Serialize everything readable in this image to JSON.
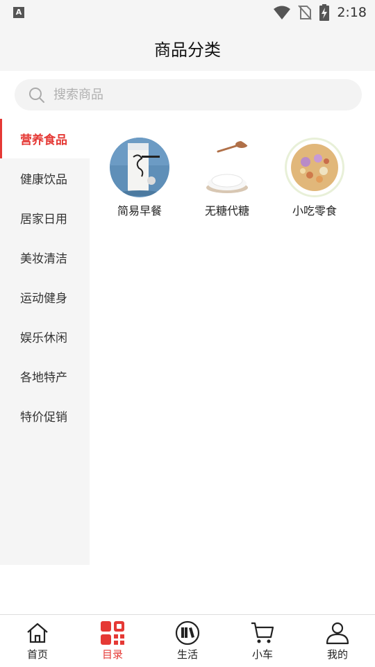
{
  "status_bar": {
    "time": "2:18",
    "notification_icon": "a-icon",
    "notification_letter": "A",
    "icons": [
      "wifi-icon",
      "no-sim-icon",
      "battery-charging-icon"
    ]
  },
  "header": {
    "title": "商品分类"
  },
  "search": {
    "placeholder": "搜索商品",
    "icon": "search-icon"
  },
  "sidebar": {
    "items": [
      {
        "label": "营养食品",
        "active": true
      },
      {
        "label": "健康饮品",
        "active": false
      },
      {
        "label": "居家日用",
        "active": false
      },
      {
        "label": "美妆清洁",
        "active": false
      },
      {
        "label": "运动健身",
        "active": false
      },
      {
        "label": "娱乐休闲",
        "active": false
      },
      {
        "label": "各地特产",
        "active": false
      },
      {
        "label": "特价促销",
        "active": false
      }
    ]
  },
  "categories": [
    {
      "label": "简易早餐",
      "icon": "milk-glass-image"
    },
    {
      "label": "无糖代糖",
      "icon": "sugar-spoon-image"
    },
    {
      "label": "小吃零食",
      "icon": "cereal-bowl-image"
    }
  ],
  "bottom_nav": {
    "items": [
      {
        "label": "首页",
        "icon": "home-icon",
        "active": false
      },
      {
        "label": "目录",
        "icon": "catalog-qr-icon",
        "active": true
      },
      {
        "label": "生活",
        "icon": "life-books-icon",
        "active": false
      },
      {
        "label": "小车",
        "icon": "cart-icon",
        "active": false
      },
      {
        "label": "我的",
        "icon": "user-icon",
        "active": false
      }
    ]
  },
  "colors": {
    "accent": "#e53935",
    "sidebar_bg": "#f5f5f5",
    "header_bg": "#f5f5f5",
    "search_bg": "#f3f3f3"
  }
}
